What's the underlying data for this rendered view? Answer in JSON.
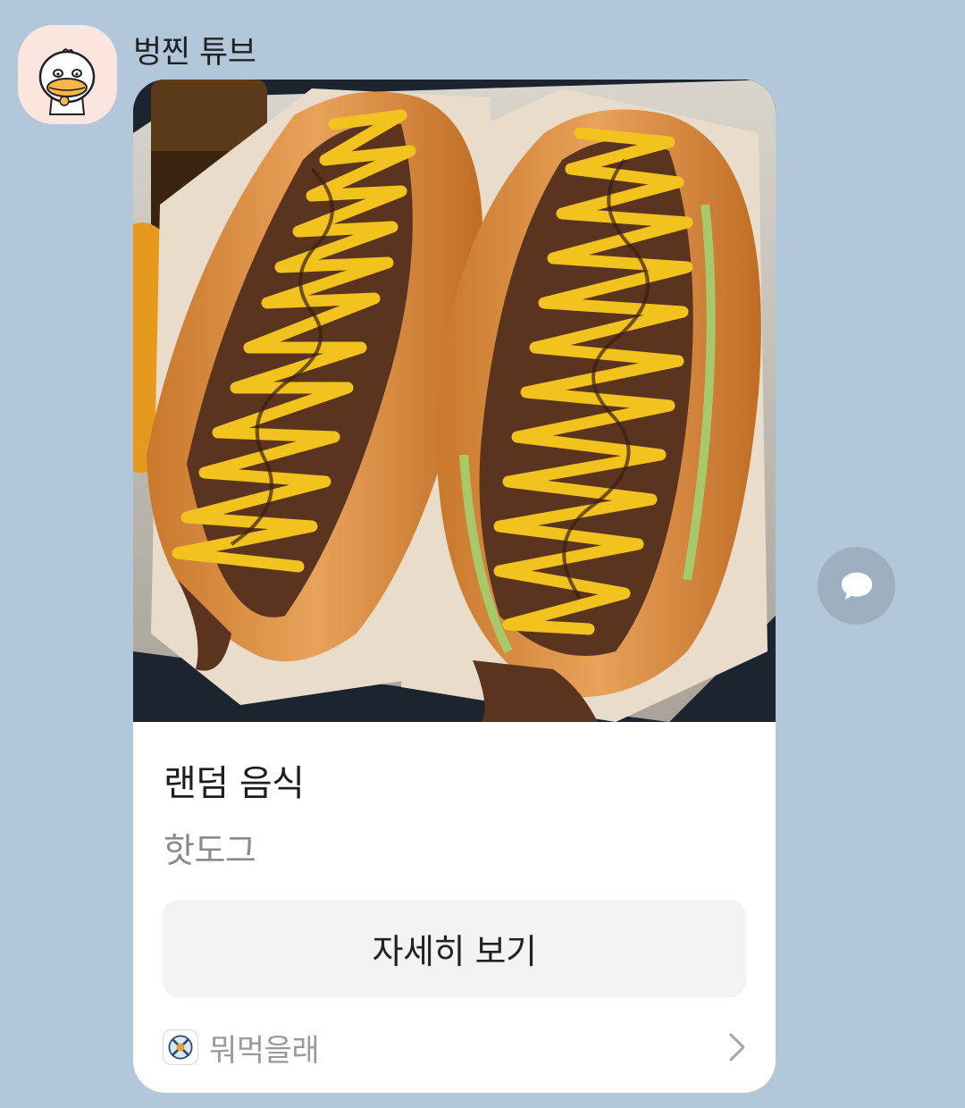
{
  "message": {
    "sender": "벙찐 튜브",
    "avatar_icon": "duck-character-avatar"
  },
  "card": {
    "image_alt": "hotdog-photo",
    "title": "랜덤 음식",
    "subtitle": "핫도그",
    "button_label": "자세히 보기",
    "channel_name": "뭐먹을래",
    "channel_icon": "app-logo-icon"
  },
  "share_icon": "speech-bubble-icon",
  "colors": {
    "chat_background": "#b2c7da",
    "card_background": "#ffffff",
    "button_background": "#f3f3f3",
    "share_button": "#9eafbf"
  }
}
